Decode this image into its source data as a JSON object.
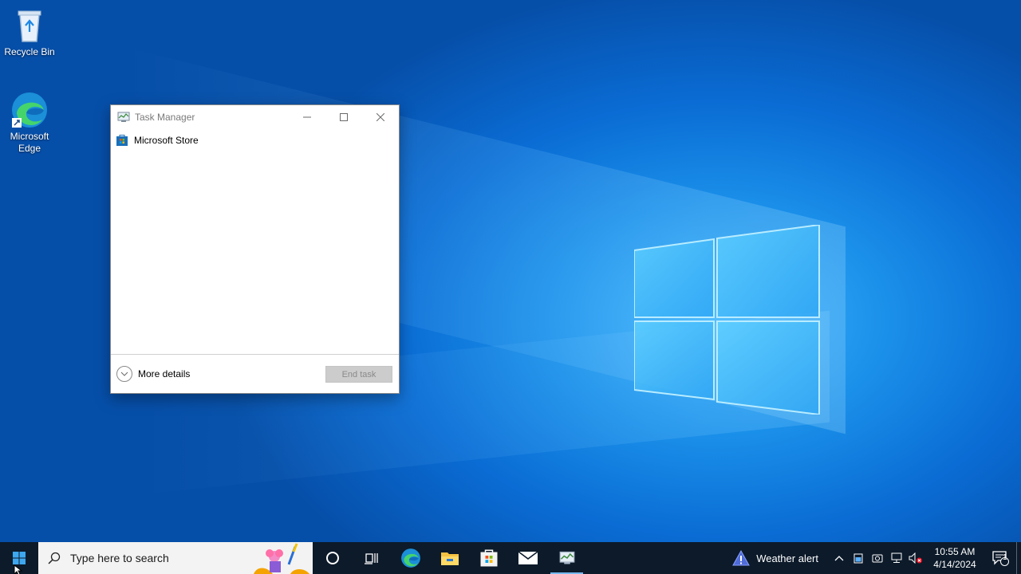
{
  "desktop": {
    "icons": [
      {
        "label": "Recycle Bin"
      },
      {
        "label": "Microsoft Edge"
      }
    ]
  },
  "task_manager": {
    "title": "Task Manager",
    "apps": [
      {
        "name": "Microsoft Store"
      }
    ],
    "more_details_label": "More details",
    "end_task_label": "End task"
  },
  "taskbar": {
    "search_placeholder": "Type here to search",
    "apps": [
      "cortana-icon",
      "task-view-icon",
      "edge-icon",
      "file-explorer-icon",
      "microsoft-store-icon",
      "mail-icon",
      "task-manager-icon"
    ],
    "weather_text": "Weather alert",
    "time": "10:55 AM",
    "date": "4/14/2024",
    "notification_count": "1"
  },
  "colors": {
    "taskbar_bg": "#0c1a2a",
    "desktop_accent": "#0a6cd4",
    "active_indicator": "#76b9ed"
  }
}
